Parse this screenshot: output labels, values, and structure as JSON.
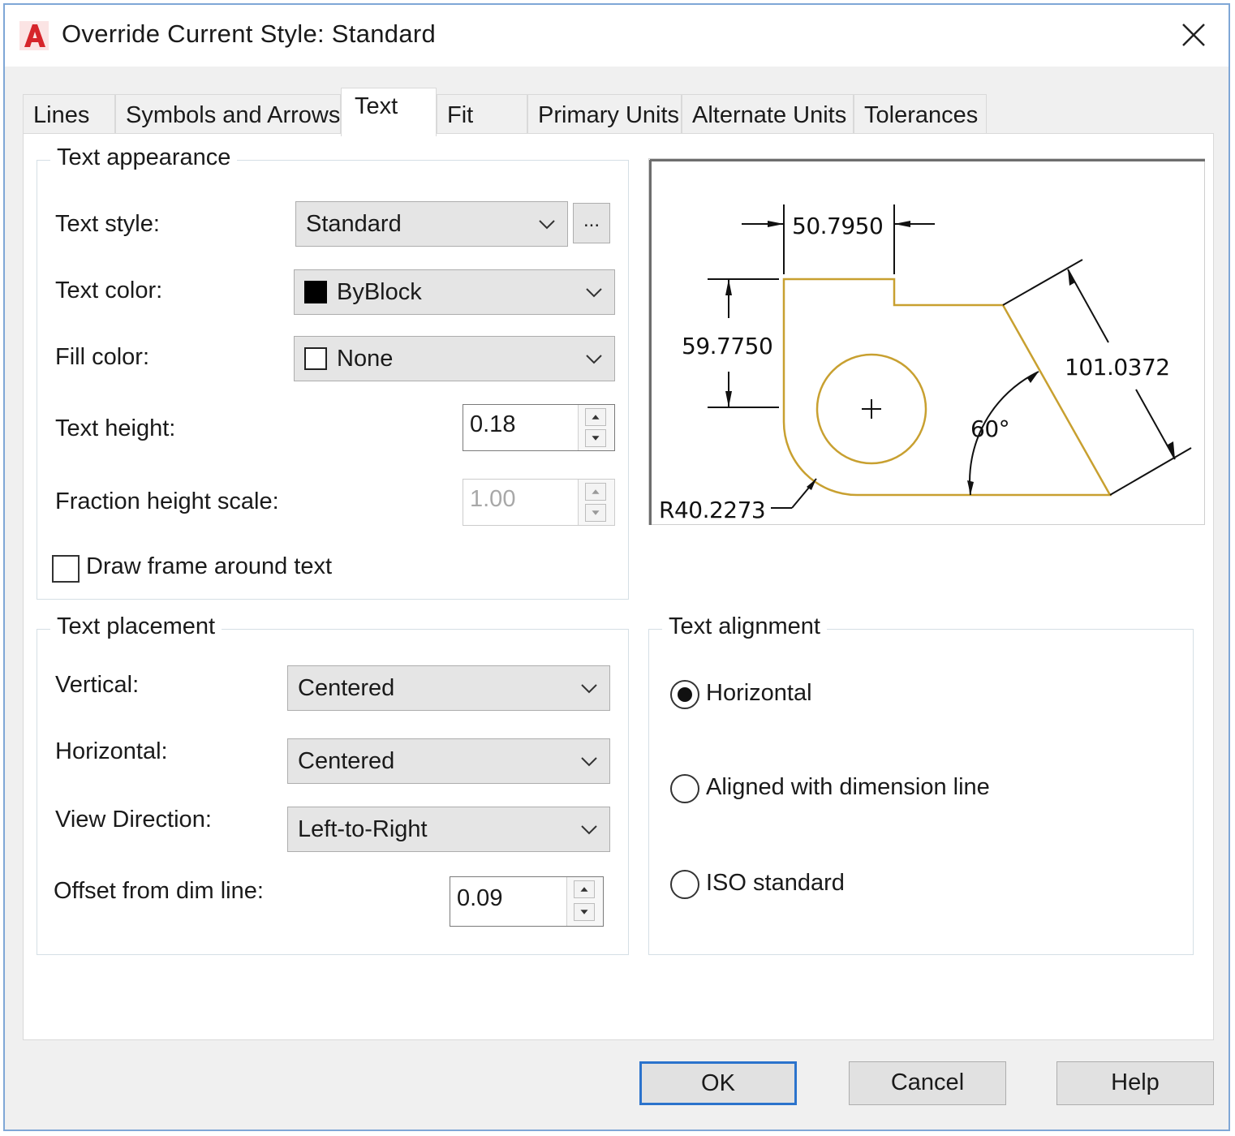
{
  "window": {
    "title": "Override Current Style: Standard"
  },
  "icons": {
    "app": "autocad-icon",
    "close": "close-icon"
  },
  "tabs": [
    {
      "label": "Lines",
      "active": false
    },
    {
      "label": "Symbols and Arrows",
      "active": false
    },
    {
      "label": "Text",
      "active": true
    },
    {
      "label": "Fit",
      "active": false
    },
    {
      "label": "Primary Units",
      "active": false
    },
    {
      "label": "Alternate Units",
      "active": false
    },
    {
      "label": "Tolerances",
      "active": false
    }
  ],
  "text_appearance": {
    "title": "Text appearance",
    "text_style": {
      "label": "Text style:",
      "value": "Standard",
      "browse_label": "..."
    },
    "text_color": {
      "label": "Text color:",
      "value": "ByBlock",
      "swatch": "#000000"
    },
    "fill_color": {
      "label": "Fill color:",
      "value": "None",
      "swatch": "#ffffff"
    },
    "text_height": {
      "label": "Text height:",
      "value": "0.18"
    },
    "fraction_height_scale": {
      "label": "Fraction height scale:",
      "value": "1.00",
      "enabled": false
    },
    "draw_frame": {
      "label": "Draw frame around text",
      "checked": false
    }
  },
  "preview": {
    "dim_top": "50.7950",
    "dim_left": "59.7750",
    "dim_right": "101.0372",
    "angle": "60°",
    "radius": "R40.2273",
    "geometry_color": "#c8a030"
  },
  "text_placement": {
    "title": "Text placement",
    "vertical": {
      "label": "Vertical:",
      "value": "Centered"
    },
    "horizontal": {
      "label": "Horizontal:",
      "value": "Centered"
    },
    "view_direction": {
      "label": "View Direction:",
      "value": "Left-to-Right"
    },
    "offset": {
      "label": "Offset from dim line:",
      "value": "0.09"
    }
  },
  "text_alignment": {
    "title": "Text alignment",
    "options": [
      {
        "label": "Horizontal",
        "selected": true
      },
      {
        "label": "Aligned with dimension line",
        "selected": false
      },
      {
        "label": "ISO standard",
        "selected": false
      }
    ]
  },
  "buttons": {
    "ok": "OK",
    "cancel": "Cancel",
    "help": "Help"
  },
  "colors": {
    "accent": "#2b73cc",
    "window_border": "#7fa7d6"
  }
}
